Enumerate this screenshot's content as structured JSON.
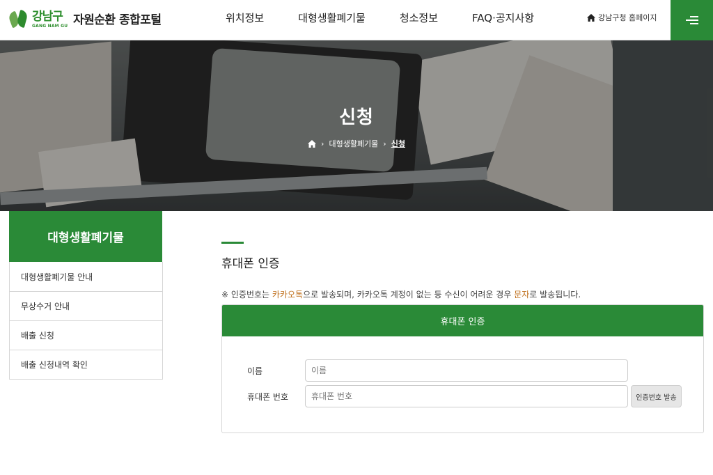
{
  "header": {
    "logo_ko": "강남구",
    "logo_en": "GANG NAM GU",
    "site_title": "자원순환 종합포털",
    "nav": [
      "위치정보",
      "대형생활폐기물",
      "청소정보",
      "FAQ·공지사항"
    ],
    "home_link": "강남구청 홈페이지",
    "menu_icon": "hamburger-icon"
  },
  "hero": {
    "title": "신청",
    "breadcrumb": [
      "대형생활폐기물",
      "신청"
    ],
    "home_icon": "home-icon"
  },
  "sidebar": {
    "title": "대형생활폐기물",
    "items": [
      "대형생활폐기물 안내",
      "무상수거 안내",
      "배출 신청",
      "배출 신청내역 확인"
    ]
  },
  "main": {
    "section_title": "휴대폰 인증",
    "notice": {
      "prefix": "※ 인증번호는 ",
      "hl1": "카카오톡",
      "mid": "으로 발송되며, 카카오톡 계정이 없는 등 수신이 어려운 경우 ",
      "hl2": "문자",
      "suffix": "로 발송됩니다."
    },
    "form": {
      "header": "휴대폰 인증",
      "name_label": "이름",
      "name_placeholder": "이름",
      "phone_label": "휴대폰 번호",
      "phone_placeholder": "휴대폰 번호",
      "send_button": "인증번호 발송"
    }
  },
  "colors": {
    "brand_green": "#2a8a37",
    "highlight": "#c0701c"
  }
}
